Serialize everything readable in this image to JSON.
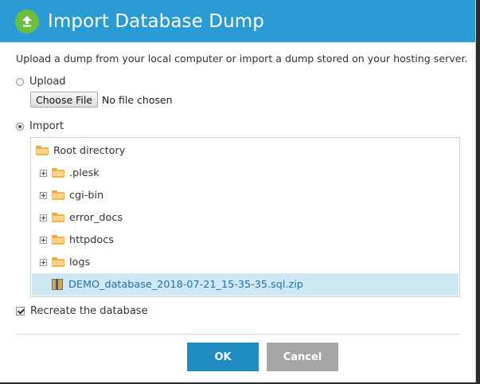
{
  "dialog": {
    "title": "Import Database Dump",
    "title_icon": "upload-arrow-icon",
    "description": "Upload a dump from your local computer or import a dump stored on your hosting server."
  },
  "upload_option": {
    "label": "Upload",
    "selected": false,
    "choose_file_label": "Choose File",
    "file_status": "No file chosen"
  },
  "import_option": {
    "label": "Import",
    "selected": true
  },
  "tree": {
    "root": "Root directory",
    "folders": [
      ".plesk",
      "cgi-bin",
      "error_docs",
      "httpdocs",
      "logs"
    ],
    "file": "DEMO_database_2018-07-21_15-35-35.sql.zip"
  },
  "recreate": {
    "label": "Recreate the database",
    "checked": true
  },
  "buttons": {
    "ok": "OK",
    "cancel": "Cancel"
  },
  "colors": {
    "titlebar": "#2a9bd4",
    "ok_button": "#1e8cc1",
    "cancel_button": "#a6a6a6",
    "selected_row": "#cfe8f5",
    "icon_green": "#6cbf3e"
  }
}
